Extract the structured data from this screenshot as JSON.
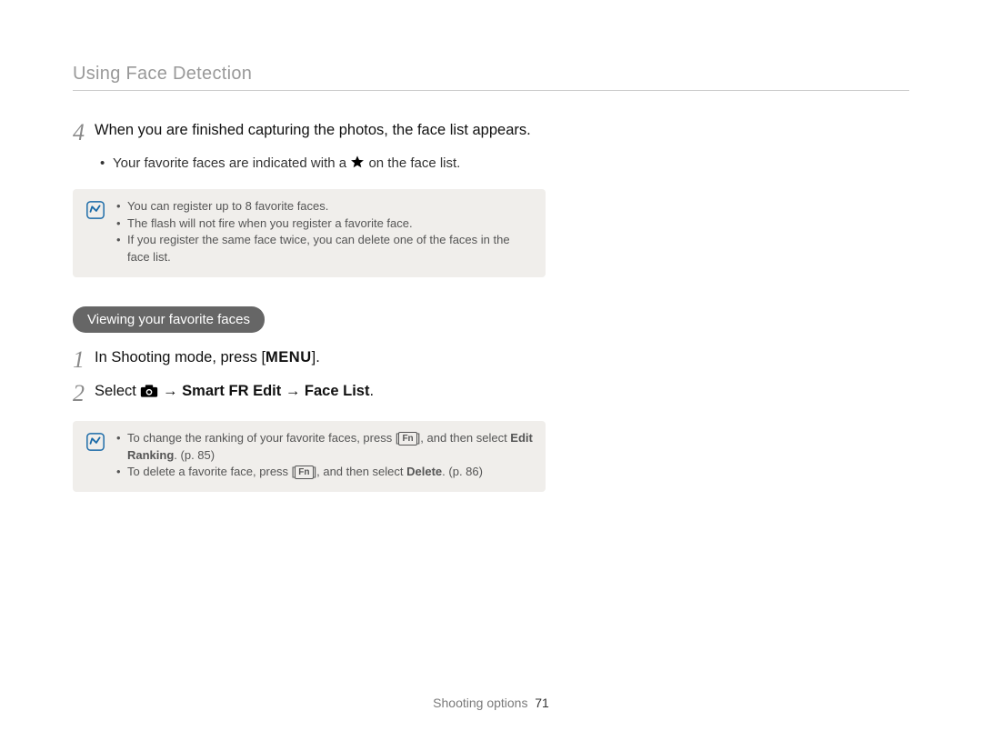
{
  "page_title": "Using Face Detection",
  "step4": {
    "number": "4",
    "text_before_star": "When you are finished capturing the photos, the face list appears.",
    "bullet_before_star": "Your favorite faces are indicated with a",
    "bullet_after_star": " on the face list."
  },
  "note1": {
    "items": [
      "You can register up to 8 favorite faces.",
      "The flash will not fire when you register a favorite face.",
      "If you register the same face twice, you can delete one of the faces in the face list."
    ]
  },
  "section_pill": "Viewing your favorite faces",
  "step1": {
    "number": "1",
    "text_before_menu": "In Shooting mode, press [",
    "menu_label": "MENU",
    "text_after_menu": "]."
  },
  "step2": {
    "number": "2",
    "text_before_icon": "Select ",
    "arrow": " → ",
    "smart_fr": "Smart FR Edit",
    "face_list": "Face List",
    "period": "."
  },
  "note2": {
    "item1_before_fn": "To change the ranking of your favorite faces, press [",
    "fn_label": "Fn",
    "item1_after_fn": "], and then select ",
    "edit_ranking": "Edit Ranking",
    "item1_page": ". (p. 85)",
    "item2_before_fn": "To delete a favorite face, press [",
    "item2_after_fn": "], and then select ",
    "delete_label": "Delete",
    "item2_page": ". (p. 86)"
  },
  "footer": {
    "section": "Shooting options",
    "page": "71"
  }
}
